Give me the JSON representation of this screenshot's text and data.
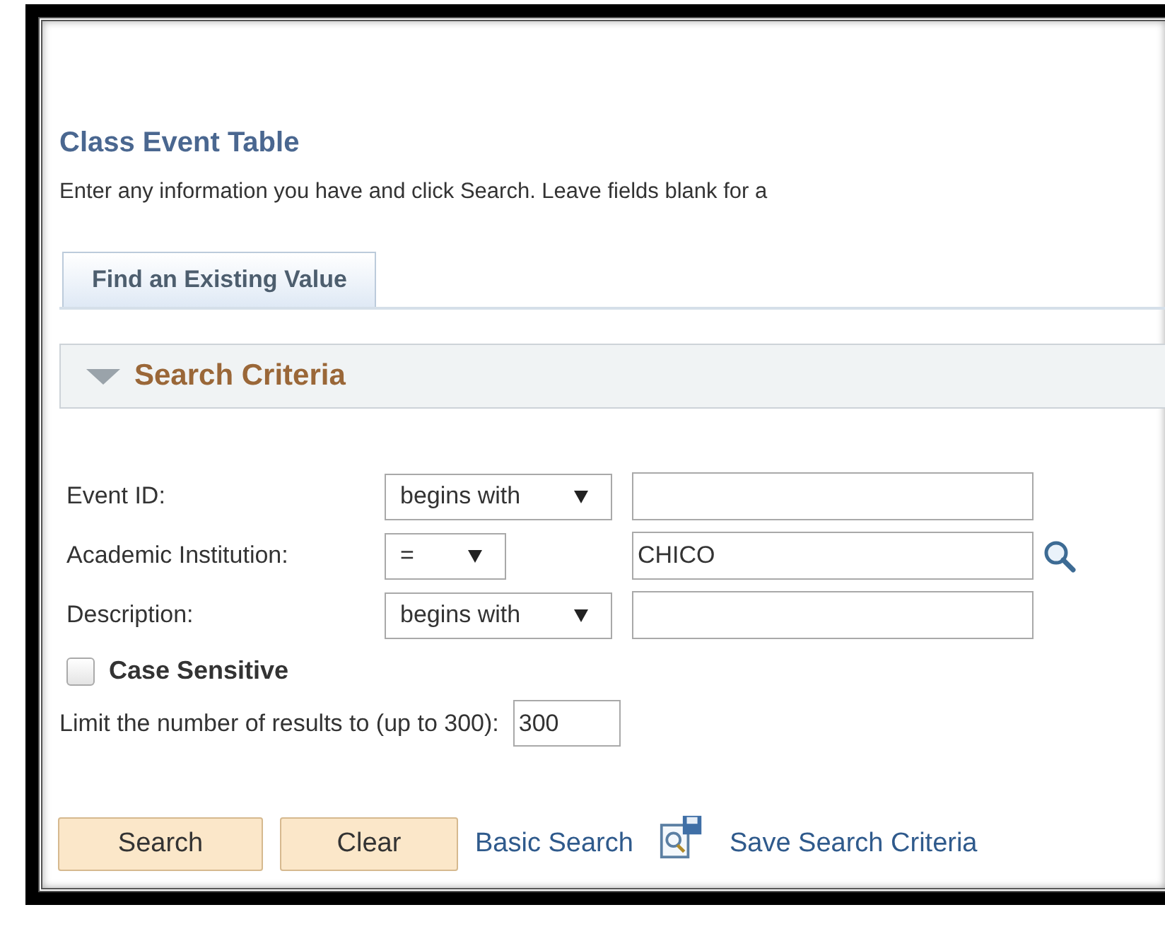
{
  "title": "Class Event Table",
  "instructions": "Enter any information you have and click Search. Leave fields blank for a",
  "tabs": [
    {
      "label": "Find an Existing Value",
      "selected": true
    }
  ],
  "section": {
    "title": "Search Criteria",
    "expanded": true
  },
  "criteria": [
    {
      "label": "Event ID:",
      "operator": "begins with",
      "lookup": false
    },
    {
      "label": "Academic Institution:",
      "operator": "=",
      "value": "CHICO",
      "lookup": true
    },
    {
      "label": "Description:",
      "operator": "begins with",
      "lookup": false
    }
  ],
  "case_sensitive": {
    "label": "Case Sensitive",
    "checked": false
  },
  "limit": {
    "label": "Limit the number of results to (up to 300):",
    "value": "300"
  },
  "actions": [
    {
      "kind": "button",
      "label": "Search"
    },
    {
      "kind": "button",
      "label": "Clear"
    },
    {
      "kind": "link",
      "label": "Basic Search"
    },
    {
      "kind": "icon-link",
      "label": "Save Search Criteria"
    }
  ]
}
